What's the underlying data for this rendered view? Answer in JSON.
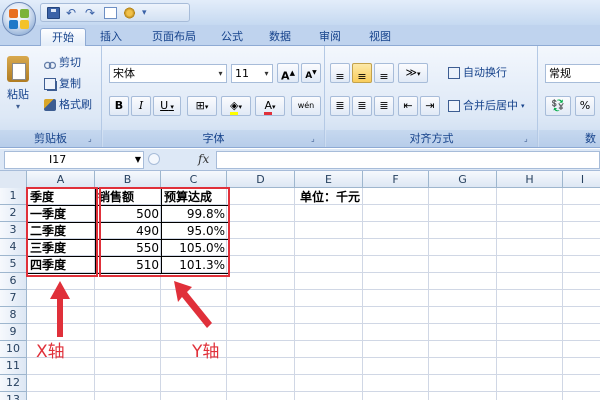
{
  "ribbon": {
    "tabs": [
      "开始",
      "插入",
      "页面布局",
      "公式",
      "数据",
      "审阅",
      "视图"
    ],
    "clipboard": {
      "paste": "粘贴",
      "cut": "剪切",
      "copy": "复制",
      "format_painter": "格式刷",
      "label": "剪贴板"
    },
    "font": {
      "name": "宋体",
      "size": "11",
      "grow": "A",
      "shrink": "A",
      "bold": "B",
      "italic": "I",
      "underline": "U",
      "font_color": "A",
      "phonetic": "wén",
      "label": "字体"
    },
    "alignment": {
      "wrap_text": "自动换行",
      "merge_center": "合并后居中",
      "label": "对齐方式"
    },
    "number": {
      "format": "常规",
      "percent": "%",
      "comma": ",",
      "label": "数"
    }
  },
  "formula_bar": {
    "name_box": "I17",
    "fx": "fx",
    "formula": ""
  },
  "sheet": {
    "columns": [
      "A",
      "B",
      "C",
      "D",
      "E",
      "F",
      "G",
      "H",
      "I"
    ],
    "rows": [
      "1",
      "2",
      "3",
      "4",
      "5",
      "6",
      "7",
      "8",
      "9",
      "10",
      "11",
      "12",
      "13"
    ],
    "headers": {
      "season": "季度",
      "sales": "销售额",
      "budget": "预算达成"
    },
    "data": [
      {
        "season": "一季度",
        "sales": "500",
        "budget": "99.8%"
      },
      {
        "season": "二季度",
        "sales": "490",
        "budget": "95.0%"
      },
      {
        "season": "三季度",
        "sales": "550",
        "budget": "105.0%"
      },
      {
        "season": "四季度",
        "sales": "510",
        "budget": "101.3%"
      }
    ],
    "unit_note": "单位：千元"
  },
  "annotations": {
    "x_axis": "X轴",
    "y_axis": "Y轴",
    "color": "#e0303a"
  }
}
